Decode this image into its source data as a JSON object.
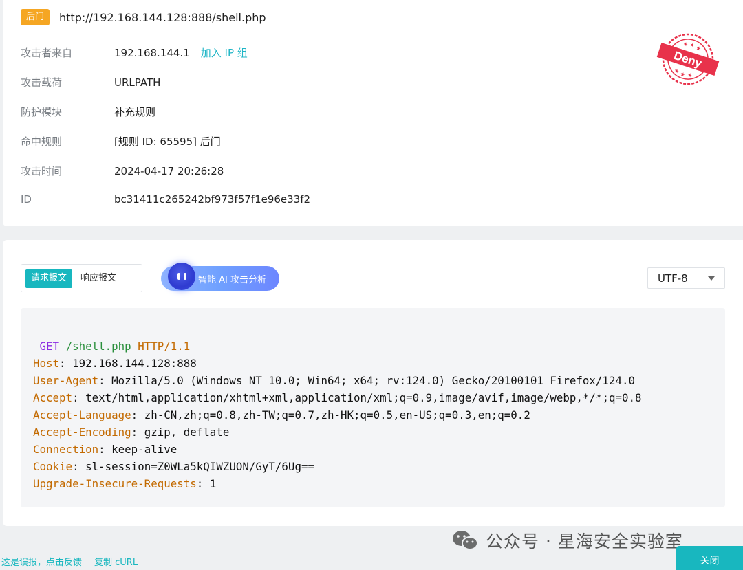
{
  "header": {
    "tag": "后门",
    "url": "http://192.168.144.128:888/shell.php"
  },
  "details": [
    {
      "label": "攻击者来自",
      "value": "192.168.144.1",
      "action": "加入 IP 组"
    },
    {
      "label": "攻击载荷",
      "value": "URLPATH"
    },
    {
      "label": "防护模块",
      "value": "补充规则"
    },
    {
      "label": "命中规则",
      "value": "[规则 ID: 65595] 后门"
    },
    {
      "label": "攻击时间",
      "value": "2024-04-17 20:26:28"
    },
    {
      "label": "ID",
      "value": "bc31411c265242bf973f57f1e96e33f2"
    }
  ],
  "stamp": {
    "text": "Deny",
    "color": "#e8324b",
    "icon": "deny-stamp-icon"
  },
  "tabs": [
    {
      "label": "请求报文",
      "active": true
    },
    {
      "label": "响应报文",
      "active": false
    }
  ],
  "ai_button": {
    "label": "智能 AI 攻击分析",
    "icon": "ai-robot-icon"
  },
  "encoding": {
    "selected": "UTF-8"
  },
  "request": {
    "method": "GET",
    "path": "/shell.php",
    "protocol": "HTTP/1.1",
    "headers": [
      {
        "key": "Host",
        "value": "192.168.144.128:888"
      },
      {
        "key": "User-Agent",
        "value": "Mozilla/5.0 (Windows NT 10.0; Win64; x64; rv:124.0) Gecko/20100101 Firefox/124.0"
      },
      {
        "key": "Accept",
        "value": "text/html,application/xhtml+xml,application/xml;q=0.9,image/avif,image/webp,*/*;q=0.8"
      },
      {
        "key": "Accept-Language",
        "value": "zh-CN,zh;q=0.8,zh-TW;q=0.7,zh-HK;q=0.5,en-US;q=0.3,en;q=0.2"
      },
      {
        "key": "Accept-Encoding",
        "value": "gzip, deflate"
      },
      {
        "key": "Connection",
        "value": "keep-alive"
      },
      {
        "key": "Cookie",
        "value": "sl-session=Z0WLa5kQIWZUON/GyT/6Ug=="
      },
      {
        "key": "Upgrade-Insecure-Requests",
        "value": "1"
      }
    ]
  },
  "footer": {
    "report_link": "这是误报，点击反馈",
    "copy_curl": "复制 cURL",
    "close": "关闭"
  },
  "watermark": {
    "text": "公众号 · 星海安全实验室",
    "icon": "wechat-icon"
  },
  "colors": {
    "accent": "#18b7bf",
    "tag": "#f5a623",
    "deny": "#e8324b"
  }
}
